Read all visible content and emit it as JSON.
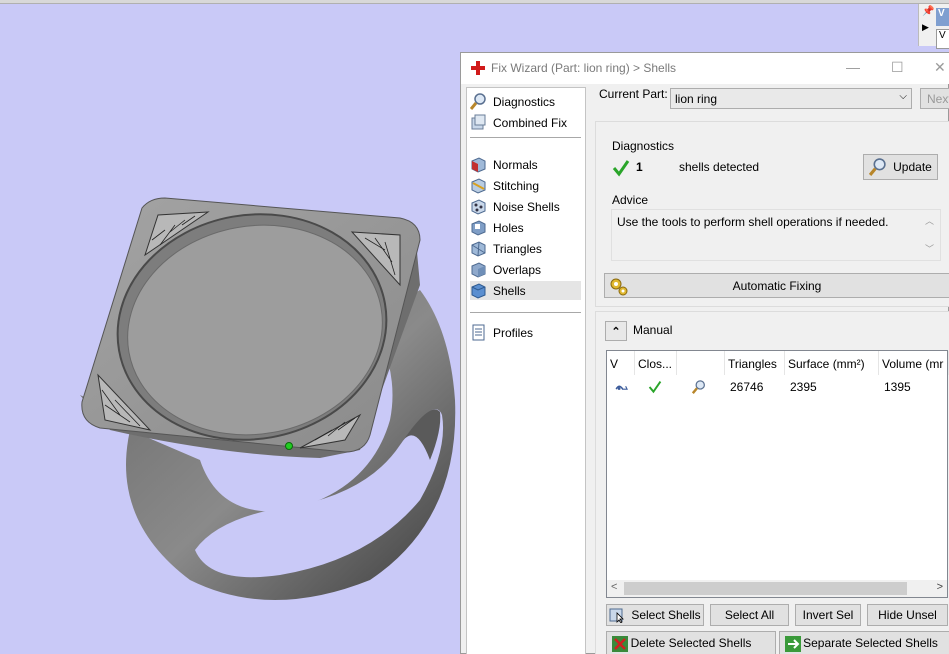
{
  "window": {
    "title": "Fix Wizard (Part: lion ring) > Shells",
    "minimize": "—",
    "maximize": "☐",
    "close": "✕"
  },
  "right_toolbar": {
    "tab_label": "V",
    "box_label": "V"
  },
  "nav": {
    "items": [
      {
        "label": "Diagnostics",
        "icon": "magnifier-icon"
      },
      {
        "label": "Combined Fix",
        "icon": "cube-stack-icon"
      },
      {
        "label": "Normals",
        "icon": "normals-cube-icon"
      },
      {
        "label": "Stitching",
        "icon": "stitching-cube-icon"
      },
      {
        "label": "Noise Shells",
        "icon": "noise-shells-icon"
      },
      {
        "label": "Holes",
        "icon": "holes-cube-icon"
      },
      {
        "label": "Triangles",
        "icon": "triangles-cube-icon"
      },
      {
        "label": "Overlaps",
        "icon": "overlaps-cube-icon"
      },
      {
        "label": "Shells",
        "icon": "shells-cube-icon",
        "selected": true
      },
      {
        "label": "Profiles",
        "icon": "document-icon"
      }
    ]
  },
  "current_part": {
    "label": "Current Part:",
    "value": "lion ring",
    "next_label": "Next"
  },
  "diagnostics": {
    "title": "Diagnostics",
    "count": "1",
    "text": "shells detected",
    "update_label": "Update"
  },
  "advice": {
    "title": "Advice",
    "text": "Use the tools to perform shell operations if needed."
  },
  "automatic_fixing_label": "Automatic Fixing",
  "manual": {
    "label": "Manual",
    "columns": [
      "V",
      "Clos...",
      "",
      "Triangles",
      "Surface (mm²)",
      "Volume (mr"
    ],
    "rows": [
      {
        "triangles": "26746",
        "surface": "2395",
        "volume": "1395"
      }
    ]
  },
  "buttons": {
    "select_shells": "Select Shells",
    "select_all": "Select All",
    "invert_sel": "Invert Sel",
    "hide_unsel": "Hide Unsel",
    "delete_selected": "Delete Selected Shells",
    "separate_selected": "Separate Selected Shells"
  },
  "colors": {
    "viewport_background": "#c9c9f7",
    "check_green": "#2aa52a",
    "selection_gray": "#e5e5e5"
  }
}
